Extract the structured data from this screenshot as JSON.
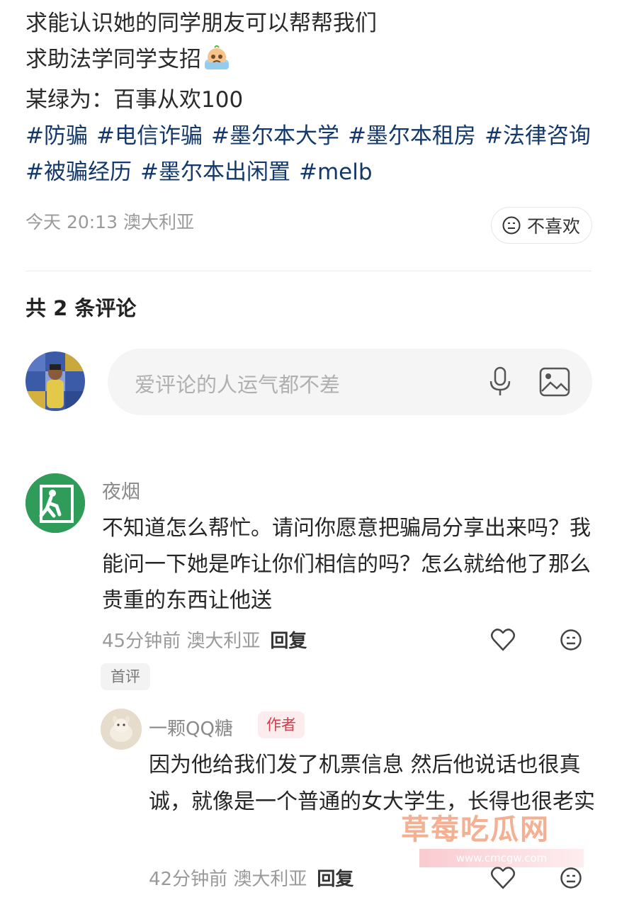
{
  "post": {
    "lines": [
      "求能认识她的同学朋友可以帮帮我们",
      "求助法学同学支招",
      "某绿为：百事从欢100"
    ],
    "tags": [
      "#防骗",
      "#电信诈骗",
      "#墨尔本大学",
      "#墨尔本租房",
      "#法律咨询",
      "#被骗经历",
      "#墨尔本出闲置",
      "#melb"
    ],
    "meta": "今天 20:13 澳大利亚",
    "dislike_label": "不喜欢"
  },
  "comments_header": "共 2 条评论",
  "comment_input": {
    "placeholder": "爱评论的人运气都不差"
  },
  "comments": [
    {
      "name": "夜烟",
      "text": "不知道怎么帮忙。请问你愿意把骗局分享出来吗？我能问一下她是咋让你们相信的吗？怎么就给他了那么贵重的东西让他送",
      "meta": "45分钟前 澳大利亚",
      "reply_label": "回复",
      "badge": "首评"
    }
  ],
  "reply": {
    "name": "一颗QQ糖",
    "author_badge": "作者",
    "text": "因为他给我们发了机票信息 然后他说话也很真诚，就像是一个普通的女大学生，长得也很老实",
    "meta": "42分钟前 澳大利亚",
    "reply_label": "回复"
  },
  "watermark": {
    "text": "草莓吃瓜网",
    "url": "www.cmcgw.com"
  },
  "icons": {
    "cry": "crying-face-icon",
    "dislike": "dislike-face-icon",
    "mic": "microphone-icon",
    "image": "image-icon",
    "like": "heart-icon"
  },
  "colors": {
    "tag": "#13386c",
    "author_badge": "#d23c4a",
    "avatar_green": "#2f9c5a"
  }
}
